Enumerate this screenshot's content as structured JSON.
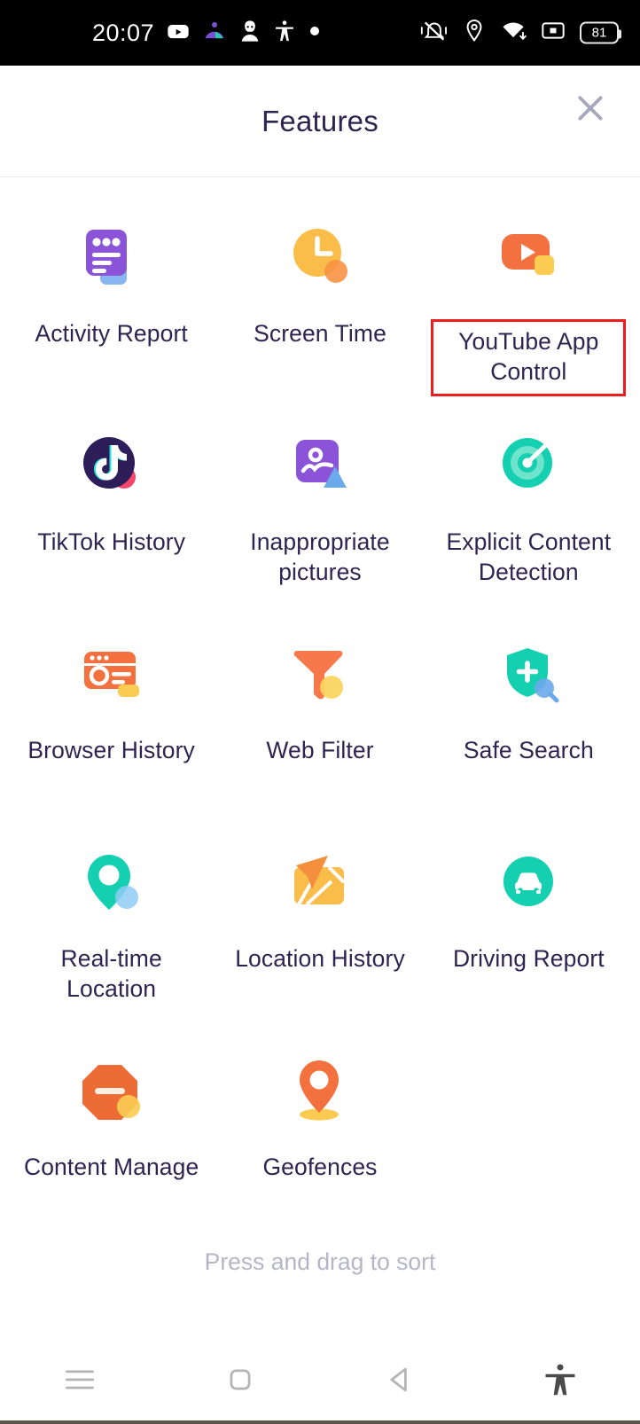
{
  "status_bar": {
    "time": "20:07",
    "battery_level": "81",
    "left_icons": [
      {
        "name": "youtube-icon",
        "label": "YouTube"
      },
      {
        "name": "family-link-icon",
        "label": "Family Link"
      },
      {
        "name": "contact-icon",
        "label": "Contact"
      },
      {
        "name": "accessibility-icon",
        "label": "Accessibility"
      },
      {
        "name": "dot-icon",
        "label": "Notification dot"
      }
    ],
    "right_icons": [
      {
        "name": "vibrate-mute-icon",
        "label": "Ringer muted"
      },
      {
        "name": "location-icon",
        "label": "Location active"
      },
      {
        "name": "wifi-icon",
        "label": "Wi-Fi"
      },
      {
        "name": "sim-icon",
        "label": "SIM"
      },
      {
        "name": "battery-icon",
        "label": "Battery"
      }
    ]
  },
  "header": {
    "title": "Features",
    "close_label": "Close"
  },
  "features": [
    {
      "label": "Activity Report",
      "icon": "activity-report-icon",
      "highlighted": false
    },
    {
      "label": "Screen Time",
      "icon": "screen-time-icon",
      "highlighted": false
    },
    {
      "label": "YouTube App Control",
      "icon": "youtube-app-control-icon",
      "highlighted": true
    },
    {
      "label": "TikTok History",
      "icon": "tiktok-history-icon",
      "highlighted": false
    },
    {
      "label": "Inappropriate pictures",
      "icon": "inappropriate-pictures-icon",
      "highlighted": false
    },
    {
      "label": "Explicit Content Detection",
      "icon": "explicit-content-detection-icon",
      "highlighted": false
    },
    {
      "label": "Browser History",
      "icon": "browser-history-icon",
      "highlighted": false
    },
    {
      "label": "Web Filter",
      "icon": "web-filter-icon",
      "highlighted": false
    },
    {
      "label": "Safe Search",
      "icon": "safe-search-icon",
      "highlighted": false
    },
    {
      "label": "Real-time Location",
      "icon": "real-time-location-icon",
      "highlighted": false
    },
    {
      "label": "Location History",
      "icon": "location-history-icon",
      "highlighted": false
    },
    {
      "label": "Driving Report",
      "icon": "driving-report-icon",
      "highlighted": false
    },
    {
      "label": "Content Manage",
      "icon": "content-manage-icon",
      "highlighted": false
    },
    {
      "label": "Geofences",
      "icon": "geofences-icon",
      "highlighted": false
    }
  ],
  "footer": {
    "sort_hint": "Press and drag to sort"
  },
  "nav_bar": [
    {
      "name": "menu-icon",
      "label": "Menu"
    },
    {
      "name": "home-icon",
      "label": "Home"
    },
    {
      "name": "back-icon",
      "label": "Back"
    },
    {
      "name": "accessibility-icon",
      "label": "Accessibility"
    }
  ],
  "colors": {
    "highlight_border": "#ee1c1c",
    "text_primary": "#2e2450",
    "text_muted": "#b6b5c6",
    "purple": "#8b54d8",
    "orange": "#f2713f",
    "yellow": "#fbbd4a",
    "teal": "#14cfb0",
    "blue": "#6aa9ea"
  }
}
